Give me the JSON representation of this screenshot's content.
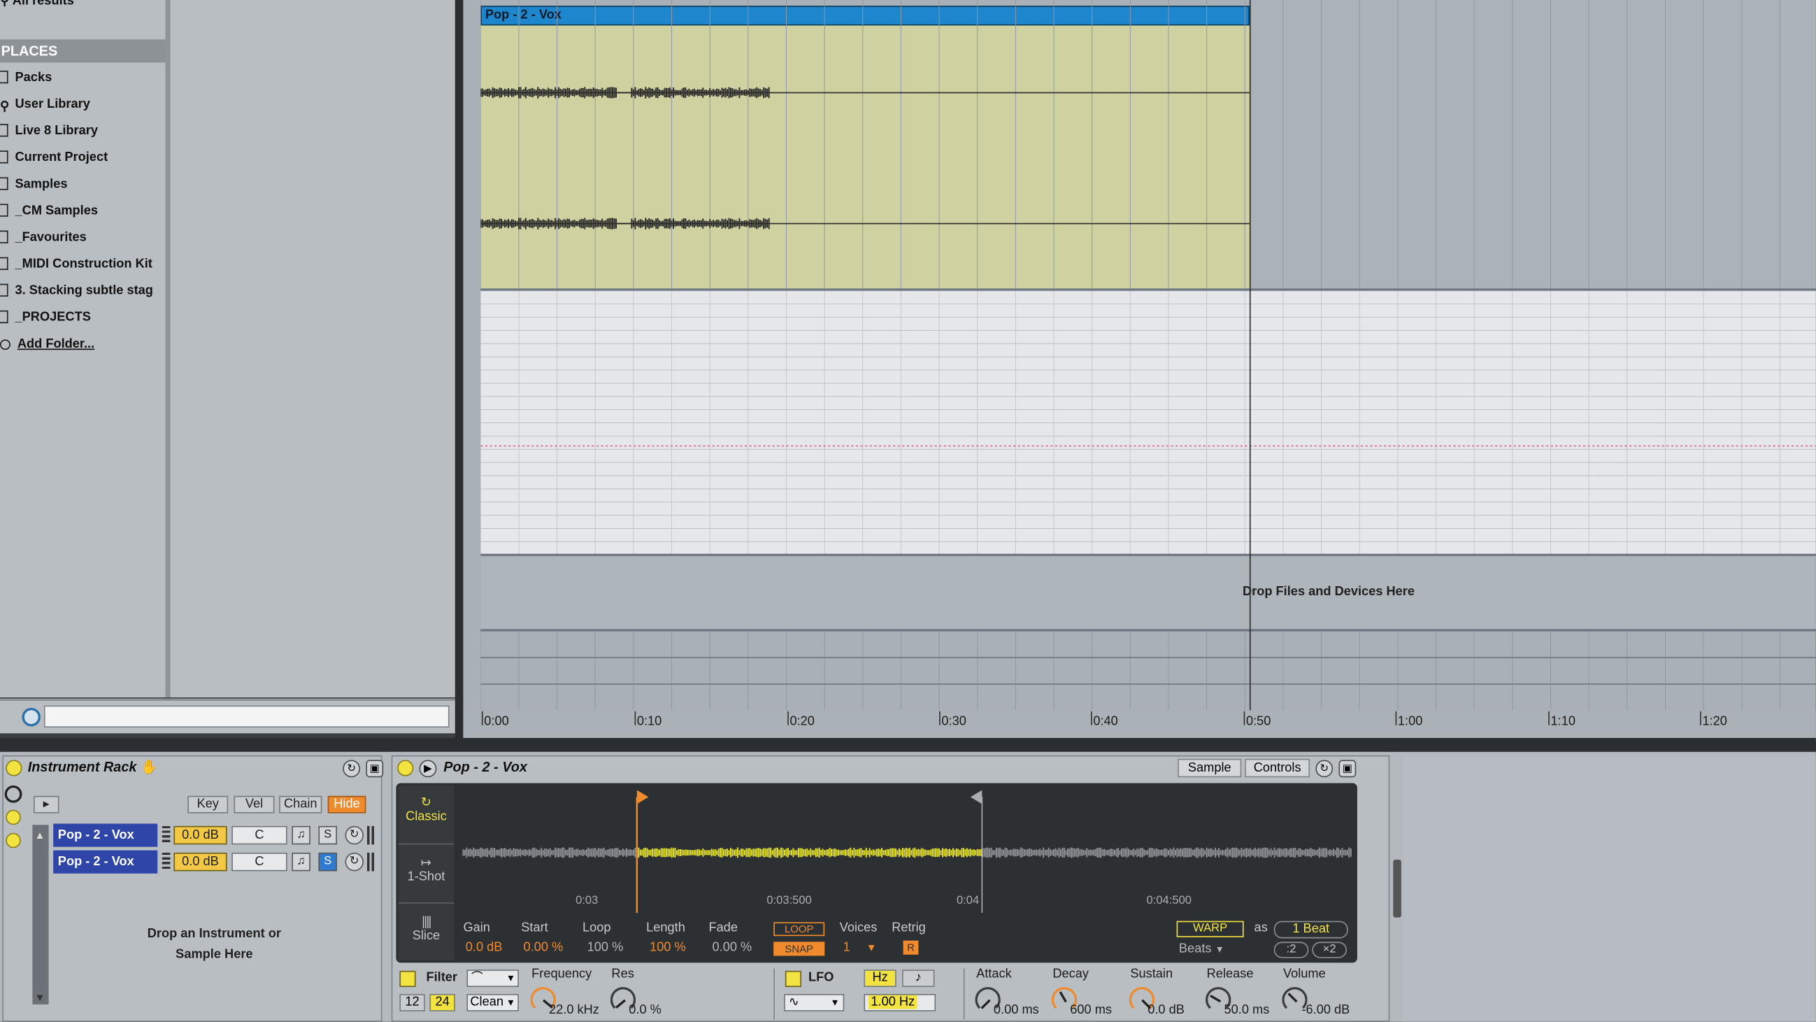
{
  "browser": {
    "top_partial_item": "All results",
    "places_header": "PLACES",
    "places": [
      {
        "label": "Packs",
        "icon": "folder-icon"
      },
      {
        "label": "User Library",
        "icon": "user-icon"
      },
      {
        "label": "Live 8 Library",
        "icon": "library-icon"
      },
      {
        "label": "Current Project",
        "icon": "project-icon"
      },
      {
        "label": "Samples",
        "icon": "folder-icon"
      },
      {
        "label": "_CM Samples",
        "icon": "folder-icon"
      },
      {
        "label": "_Favourites",
        "icon": "folder-icon"
      },
      {
        "label": "_MIDI Construction Kit",
        "icon": "folder-icon"
      },
      {
        "label": "3. Stacking subtle stag",
        "icon": "folder-icon"
      },
      {
        "label": "_PROJECTS",
        "icon": "folder-icon"
      },
      {
        "label": "Add Folder...",
        "icon": "add-icon"
      }
    ],
    "search_value": ""
  },
  "arrangement": {
    "clip_name": "Pop - 2 - Vox",
    "drop_label": "Drop Files and Devices Here",
    "timeline": [
      "0:00",
      "0:10",
      "0:20",
      "0:30",
      "0:40",
      "0:50",
      "1:00",
      "1:10",
      "1:20"
    ]
  },
  "rack": {
    "title": "Instrument Rack",
    "buttons": {
      "key": "Key",
      "vel": "Vel",
      "chain": "Chain",
      "hide": "Hide"
    },
    "chains": [
      {
        "name": "Pop - 2 - Vox",
        "volume": "0.0 dB",
        "pan": "C",
        "solo": "S",
        "solo_active": false
      },
      {
        "name": "Pop - 2 - Vox",
        "volume": "0.0 dB",
        "pan": "C",
        "solo": "S",
        "solo_active": true
      }
    ],
    "drop_text_1": "Drop an Instrument or",
    "drop_text_2": "Sample Here"
  },
  "sampler": {
    "title": "Pop - 2 - Vox",
    "tabs": {
      "sample": "Sample",
      "controls": "Controls"
    },
    "modes": {
      "classic": "Classic",
      "one_shot": "1-Shot",
      "slice": "Slice"
    },
    "time_markers": [
      "0:03",
      "0:03:500",
      "0:04",
      "0:04:500"
    ],
    "params": {
      "gain": {
        "label": "Gain",
        "value": "0.0 dB"
      },
      "start": {
        "label": "Start",
        "value": "0.00 %"
      },
      "loop": {
        "label": "Loop",
        "value": "100 %"
      },
      "length": {
        "label": "Length",
        "value": "100 %"
      },
      "fade": {
        "label": "Fade",
        "value": "0.00 %"
      },
      "loop_btn": "LOOP",
      "snap_btn": "SNAP",
      "voices": {
        "label": "Voices",
        "value": "1"
      },
      "retrig": {
        "label": "Retrig",
        "value": "R"
      },
      "warp_btn": "WARP",
      "as_label": "as",
      "beat_value": "1 Beat",
      "warp_mode": "Beats",
      "div2": ":2",
      "mul2": "×2"
    },
    "filter": {
      "label": "Filter",
      "slope_12": "12",
      "slope_24": "24",
      "circuit": "Clean",
      "frequency_label": "Frequency",
      "frequency_value": "22.0 kHz",
      "res_label": "Res",
      "res_value": "0.0 %"
    },
    "lfo": {
      "label": "LFO",
      "hz_btn": "Hz",
      "note_btn": "♪",
      "rate": "1.00 Hz"
    },
    "envelope": {
      "attack_label": "Attack",
      "attack_value": "0.00 ms",
      "decay_label": "Decay",
      "decay_value": "600 ms",
      "sustain_label": "Sustain",
      "sustain_value": "0.0 dB",
      "release_label": "Release",
      "release_value": "50.0 ms",
      "volume_label": "Volume",
      "volume_value": "-6.00 dB"
    }
  }
}
